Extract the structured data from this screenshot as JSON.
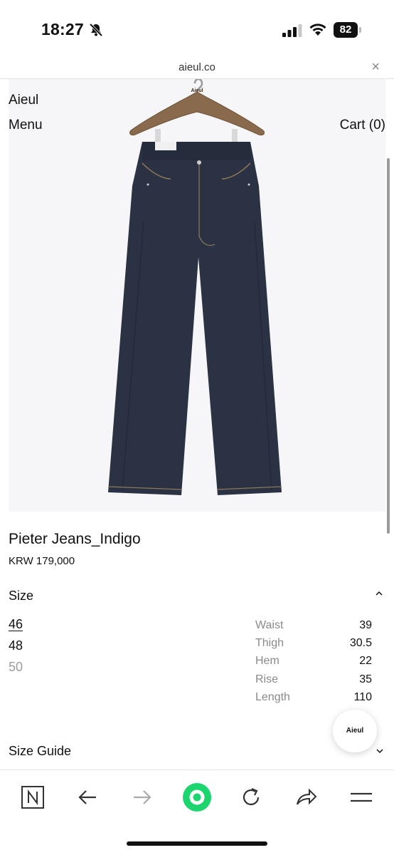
{
  "status_bar": {
    "time": "18:27",
    "battery_level": "82"
  },
  "browser": {
    "url": "aieul.co",
    "close_label": "×"
  },
  "site": {
    "logo": "Aieul",
    "menu_label": "Menu",
    "cart_label": "Cart (0)",
    "hanger_tag": "Aieul"
  },
  "product": {
    "title": "Pieter Jeans_Indigo",
    "price": "KRW 179,000"
  },
  "size_section": {
    "header": "Size",
    "options": [
      {
        "label": "46",
        "state": "selected"
      },
      {
        "label": "48",
        "state": "available"
      },
      {
        "label": "50",
        "state": "disabled"
      }
    ],
    "measurements": [
      {
        "label": "Waist",
        "value": "39"
      },
      {
        "label": "Thigh",
        "value": "30.5"
      },
      {
        "label": "Hem",
        "value": "22"
      },
      {
        "label": "Rise",
        "value": "35"
      },
      {
        "label": "Length",
        "value": "110"
      }
    ]
  },
  "size_guide": {
    "label": "Size Guide"
  },
  "chat_widget": {
    "label": "Aieul"
  },
  "toolbar": {
    "icons": [
      "n-logo-icon",
      "back-arrow-icon",
      "forward-arrow-icon",
      "green-dot-icon",
      "reload-icon",
      "share-icon",
      "menu-icon"
    ]
  },
  "colors": {
    "denim": "#2a3244",
    "accent_green": "#1dd56f",
    "muted_text": "#8a8a8a"
  }
}
